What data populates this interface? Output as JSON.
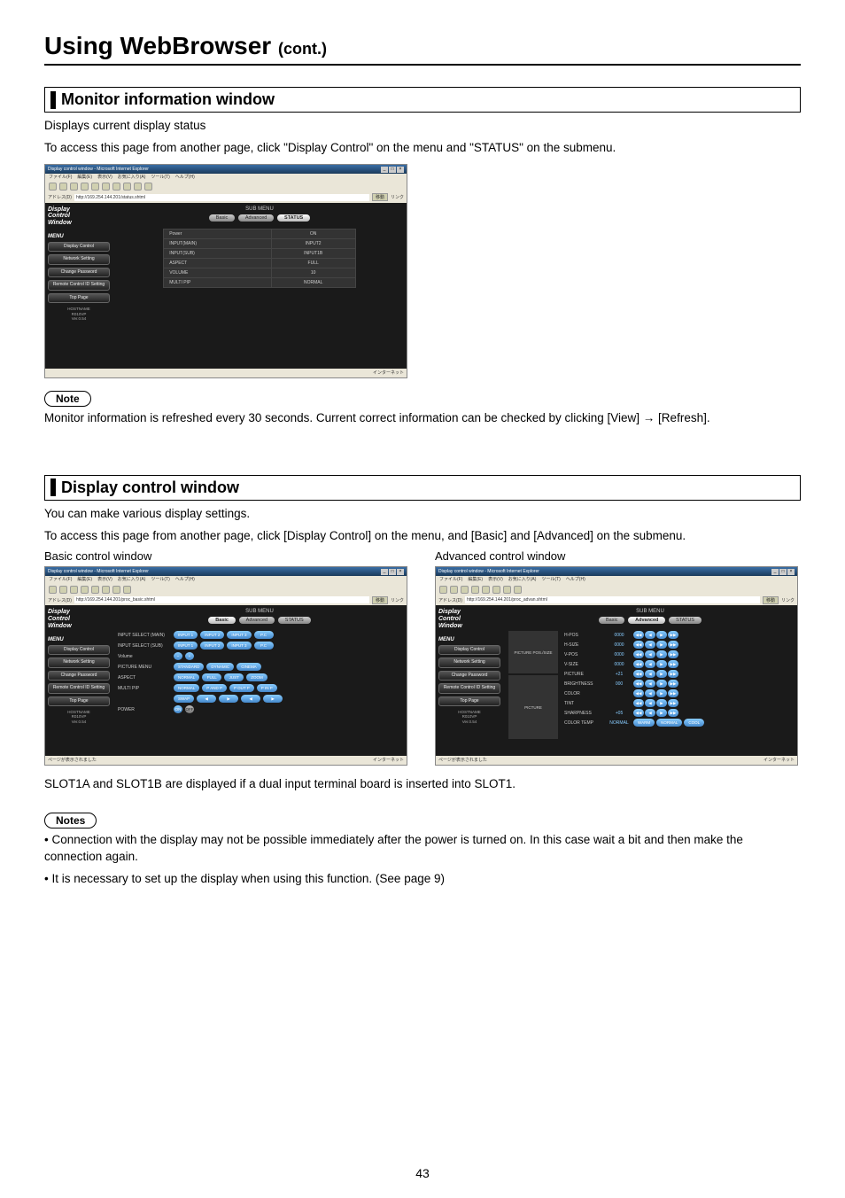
{
  "page_title_main": "Using WebBrowser",
  "page_title_suffix": "(cont.)",
  "section1": {
    "header": "Monitor information window",
    "line1": "Displays current display status",
    "line2": "To access this page from another page, click \"Display Control\" on the menu and \"STATUS\" on the submenu.",
    "note_label": "Note",
    "note_text": "Monitor information is refreshed every 30 seconds. Current correct information can be checked by clicking [View] → [Refresh]."
  },
  "section2": {
    "header": "Display control window",
    "line1": "You can make various display settings.",
    "line2": "To access this page from another page, click [Display Control] on the menu, and [Basic] and [Advanced] on the submenu.",
    "caption_basic": "Basic control window",
    "caption_advanced": "Advanced control window",
    "after_text": "SLOT1A and SLOT1B are displayed if a dual input terminal board is inserted into SLOT1.",
    "notes_label": "Notes",
    "note1": "• Connection with the display may not be possible immediately after the power is turned on. In this case wait a bit and then make the connection again.",
    "note2": "• It is necessary to set up the display when using this function. (See page 9)"
  },
  "ie_common": {
    "title": "Display control window - Microsoft Internet Explorer",
    "menubar": [
      "ファイル(F)",
      "編集(E)",
      "表示(V)",
      "お気に入り(A)",
      "ツール(T)",
      "ヘルプ(H)"
    ],
    "addr_label": "アドレス(D)",
    "go": "移動",
    "links": "リンク",
    "dcw": {
      "l1": "Display",
      "l2": "Control",
      "l3": "Window"
    },
    "menu": "MENU",
    "sb_display": "Display\nControl",
    "sb_network": "Network Setting",
    "sb_change": "Change\nPassword",
    "sb_remote": "Remote Control ID\nSetting",
    "sb_top": "Top Page",
    "host_l1": "HOSTNAME",
    "host_l2": "R010VP",
    "host_l3": "Ver.0.54",
    "submenu": "SUB MENU",
    "tab_basic": "Basic",
    "tab_adv": "Advanced",
    "tab_status": "STATUS",
    "statusbar_left": "ページが表示されました",
    "statusbar_right": "インターネット"
  },
  "status_window": {
    "url": "http://169.254.144.201/status.shtml",
    "rows": [
      [
        "Power",
        "ON"
      ],
      [
        "INPUT(MAIN)",
        "INPUT2"
      ],
      [
        "INPUT(SUB)",
        "INPUT1B"
      ],
      [
        "ASPECT",
        "FULL"
      ],
      [
        "VOLUME",
        "10"
      ],
      [
        "MULTI PIP",
        "NORMAL"
      ]
    ]
  },
  "basic_window": {
    "url": "http://169.254.144.201/proc_basic.shtml",
    "rows": [
      {
        "label": "INPUT SELECT (MAIN)",
        "buttons": [
          "INPUT 1",
          "INPUT 2",
          "INPUT 3",
          "P.C"
        ]
      },
      {
        "label": "INPUT SELECT (SUB)",
        "buttons": [
          "INPUT 1",
          "INPUT 2",
          "INPUT 3",
          "P.C"
        ]
      },
      {
        "label": "Volume",
        "buttons": [
          "−",
          "+"
        ]
      },
      {
        "label": "PICTURE MENU",
        "buttons": [
          "STANDARD",
          "DYNAMIC",
          "CINEMA"
        ]
      },
      {
        "label": "ASPECT",
        "buttons": [
          "NORMAL",
          "FULL",
          "JUST",
          "ZOOM"
        ]
      },
      {
        "label": "MULTI PIP",
        "buttons_r1": [
          "NORMAL",
          "P AND P",
          "P OUT P",
          "P IN P"
        ],
        "buttons_r2": [
          "SWAP",
          "◀",
          "▶",
          "◀",
          "▶"
        ]
      },
      {
        "label": "POWER",
        "buttons": [
          "ON",
          "OFF"
        ]
      }
    ]
  },
  "advanced_window": {
    "url": "http://169.254.144.201/proc_advan.shtml",
    "group1_label": "PICTURE POS./SIZE",
    "group1": [
      {
        "name": "H-POS",
        "val": "0000"
      },
      {
        "name": "H-SIZE",
        "val": "0000"
      },
      {
        "name": "V-POS",
        "val": "0000"
      },
      {
        "name": "V-SIZE",
        "val": "0000"
      }
    ],
    "group2_label": "PICTURE",
    "group2": [
      {
        "name": "PICTURE",
        "val": "+21"
      },
      {
        "name": "BRIGHTNESS",
        "val": "000"
      },
      {
        "name": "COLOR",
        "val": ""
      },
      {
        "name": "TINT",
        "val": ""
      },
      {
        "name": "SHARPNESS",
        "val": "+05"
      },
      {
        "name": "COLOR TEMP",
        "val": "NORMAL",
        "opts": [
          "WARM",
          "NORMAL",
          "COOL"
        ]
      }
    ]
  },
  "page_number": "43"
}
